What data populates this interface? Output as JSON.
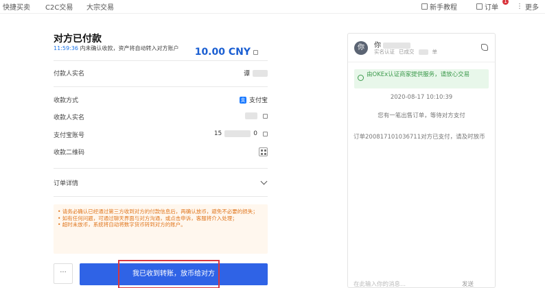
{
  "topnav": {
    "items": [
      "快捷买卖",
      "C2C交易",
      "大宗交易"
    ],
    "tutorial": "新手教程",
    "orders": "订单",
    "orders_badge": "1",
    "more": "更多"
  },
  "order": {
    "title": "对方已付款",
    "countdown_time": "11:59:36",
    "countdown_text": "内未确认收款，资产将自动转入对方账户",
    "amount": "10.00 CNY",
    "payer_label": "付款人实名",
    "payer_value": "谭",
    "method_label": "收款方式",
    "method_value": "支付宝",
    "payee_label": "收款人实名",
    "alipay_label": "支付宝账号",
    "alipay_prefix": "15",
    "alipay_suffix": "0",
    "qr_label": "收款二维码",
    "details_label": "订单详情"
  },
  "notice": [
    "• 请务必确认已经通过第三方收到对方的付款信息后，再确认放币，避免不必要的损失；",
    "• 如有任何问题，可通过聊天界面与对方沟通，或点击申诉，客服将介入处理；",
    "• 超时未放币，系统将自动将数字货币转到对方的账户。"
  ],
  "actions": {
    "more": "···",
    "confirm": "我已收到转账，放币给对方"
  },
  "chat": {
    "avatar_letter": "你",
    "name": "你",
    "meta_verified": "实名认证",
    "meta_deals_prefix": "已成交",
    "meta_deals_suffix": "单",
    "verify_text": "由OKEx认证商家提供服务，请放心交易",
    "time": "2020-08-17 10:10:39",
    "msg1": "您有一笔出售订单，等待对方支付",
    "msg2": "订单20081710103671​1对方已支付，请及时放币",
    "input_placeholder": "在此输入你的消息...",
    "send": "发送"
  },
  "colors": {
    "primary": "#2f63e6",
    "amount": "#1b5fd2",
    "warning": "#e0761d",
    "success": "#3c9a4c",
    "highlight": "#d9363e"
  }
}
